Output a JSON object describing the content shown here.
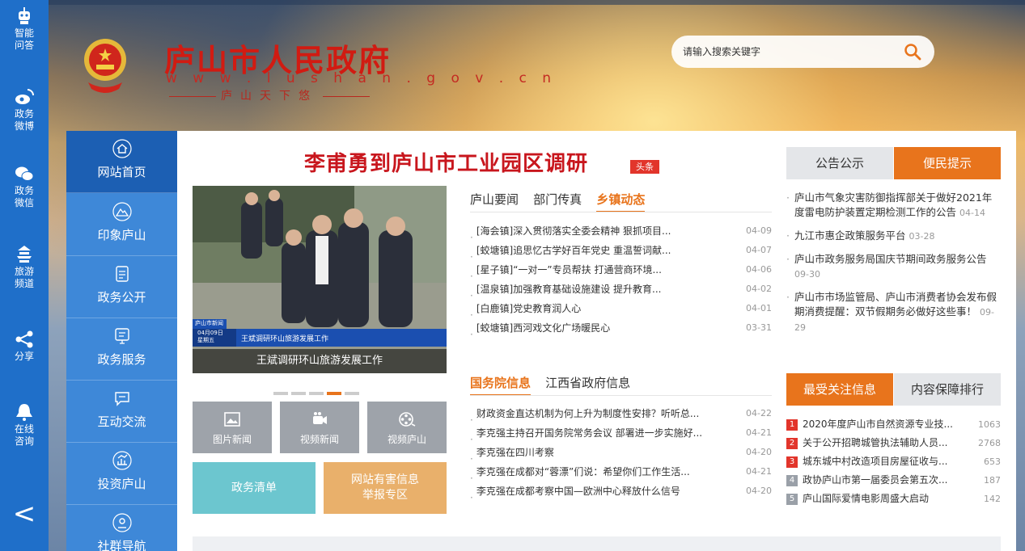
{
  "rail": {
    "items": [
      {
        "label1": "智能",
        "label2": "问答",
        "icon": "robot-icon"
      },
      {
        "label1": "政务",
        "label2": "微博",
        "icon": "weibo-icon"
      },
      {
        "label1": "政务",
        "label2": "微信",
        "icon": "wechat-icon"
      },
      {
        "label1": "旅游",
        "label2": "频道",
        "icon": "pagoda-icon"
      },
      {
        "label1": "分享",
        "label2": "",
        "icon": "share-icon"
      },
      {
        "label1": "在线",
        "label2": "咨询",
        "icon": "bell-icon"
      }
    ],
    "back": "<"
  },
  "header": {
    "title": "庐山市人民政府",
    "url": "w w w . l u s h a n . g o v . c n",
    "motto": "庐山天下悠",
    "search_placeholder": "请输入搜索关键字"
  },
  "nav": {
    "items": [
      {
        "label": "网站首页",
        "icon": "home-icon"
      },
      {
        "label": "印象庐山",
        "icon": "mountain-icon"
      },
      {
        "label": "政务公开",
        "icon": "document-icon"
      },
      {
        "label": "政务服务",
        "icon": "monitor-icon"
      },
      {
        "label": "互动交流",
        "icon": "chat-icon"
      },
      {
        "label": "投资庐山",
        "icon": "chart-icon"
      },
      {
        "label": "社群导航",
        "icon": "location-icon"
      }
    ]
  },
  "headline": {
    "title": "李甫勇到庐山市工业园区调研",
    "badge": "头条"
  },
  "photo": {
    "caption": "王斌调研环山旅游发展工作",
    "tv_label": "庐山市新闻",
    "tv_date": "04月09日",
    "tv_weekday": "星期五",
    "tv_title": "王斌调研环山旅游发展工作"
  },
  "media_buttons": [
    {
      "label": "图片新闻",
      "icon": "image-icon"
    },
    {
      "label": "视频新闻",
      "icon": "camera-icon"
    },
    {
      "label": "视频庐山",
      "icon": "film-reel-icon"
    }
  ],
  "list_buttons": [
    {
      "label": "政务清单",
      "color": "#6cc6cf"
    },
    {
      "label1": "网站有害信息",
      "label2": "举报专区",
      "color": "#e9b06b"
    }
  ],
  "tabs1": [
    "庐山要闻",
    "部门传真",
    "乡镇动态"
  ],
  "news1": [
    {
      "title": "[海会镇]深入贯彻落实全委会精神 狠抓项目...",
      "date": "04-09"
    },
    {
      "title": "[蛟塘镇]追思忆古学好百年党史 重温誓词献...",
      "date": "04-07"
    },
    {
      "title": "[星子镇]“一对一”专员帮扶 打通营商环境...",
      "date": "04-06"
    },
    {
      "title": "[温泉镇]加强教育基础设施建设 提升教育...",
      "date": "04-02"
    },
    {
      "title": "[白鹿镇]党史教育润人心",
      "date": "04-01"
    },
    {
      "title": "[蛟塘镇]西河戏文化广场暖民心",
      "date": "03-31"
    }
  ],
  "tabs2": [
    "国务院信息",
    "江西省政府信息"
  ],
  "news2": [
    {
      "title": "财政资金直达机制为何上升为制度性安排？听听总...",
      "date": "04-22"
    },
    {
      "title": "李克强主持召开国务院常务会议 部署进一步实施好...",
      "date": "04-21"
    },
    {
      "title": "李克强在四川考察",
      "date": "04-20"
    },
    {
      "title": "李克强在成都对“蓉漂”们说：希望你们工作生活...",
      "date": "04-21"
    },
    {
      "title": "李克强在成都考察中国—欧洲中心释放什么信号",
      "date": "04-20"
    }
  ],
  "rtabs1": [
    "公告公示",
    "便民提示"
  ],
  "notices": [
    {
      "text": "庐山市气象灾害防御指挥部关于做好2021年度雷电防护装置定期检测工作的公告",
      "date": "04-14"
    },
    {
      "text": "九江市惠企政策服务平台",
      "date": "03-28"
    },
    {
      "text": "庐山市政务服务局国庆节期间政务服务公告",
      "date": "09-30"
    },
    {
      "text": "庐山市市场监管局、庐山市消费者协会发布假期消费提醒：双节假期务必做好这些事！",
      "date": "09-29"
    }
  ],
  "rtabs2": [
    "最受关注信息",
    "内容保障排行"
  ],
  "hot": [
    {
      "n": "1",
      "title": "2020年度庐山市自然资源专业技...",
      "count": "1063",
      "color": "#e2352b"
    },
    {
      "n": "2",
      "title": "关于公开招聘城管执法辅助人员...",
      "count": "2768",
      "color": "#e2352b"
    },
    {
      "n": "3",
      "title": "城东城中村改造项目房屋征收与...",
      "count": "653",
      "color": "#e2352b"
    },
    {
      "n": "4",
      "title": "政协庐山市第一届委员会第五次...",
      "count": "187",
      "color": "#9aa0a8"
    },
    {
      "n": "5",
      "title": "庐山国际爱情电影周盛大启动",
      "count": "142",
      "color": "#9aa0a8"
    }
  ]
}
